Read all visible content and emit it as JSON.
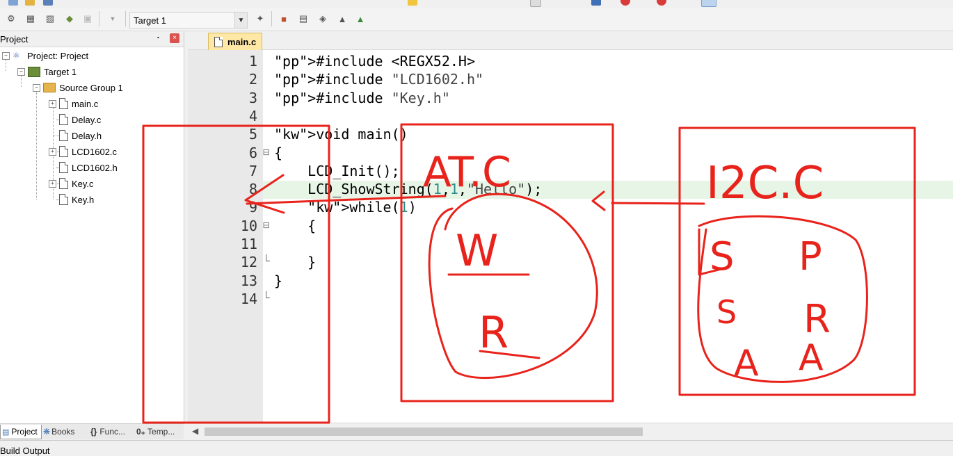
{
  "toolbar": {
    "target_name": "Target 1"
  },
  "project_panel": {
    "title": "Project",
    "pin_label": "⬝",
    "close_label": "×",
    "tree": [
      {
        "label": "Project: Project",
        "icon": "project-icon",
        "level": 0
      },
      {
        "label": "Target 1",
        "icon": "target-icon",
        "level": 1
      },
      {
        "label": "Source Group 1",
        "icon": "folder-icon",
        "level": 2
      },
      {
        "label": "main.c",
        "icon": "file-icon",
        "level": 3,
        "expandable": true
      },
      {
        "label": "Delay.c",
        "icon": "file-icon",
        "level": 3,
        "expandable": false
      },
      {
        "label": "Delay.h",
        "icon": "file-icon",
        "level": 3,
        "expandable": false
      },
      {
        "label": "LCD1602.c",
        "icon": "file-icon",
        "level": 3,
        "expandable": true
      },
      {
        "label": "LCD1602.h",
        "icon": "file-icon",
        "level": 3,
        "expandable": false
      },
      {
        "label": "Key.c",
        "icon": "file-icon",
        "level": 3,
        "expandable": true
      },
      {
        "label": "Key.h",
        "icon": "file-icon",
        "level": 3,
        "expandable": false
      }
    ],
    "bottom_tabs": [
      "Project",
      "Books",
      "Func...",
      "Temp..."
    ]
  },
  "editor": {
    "tab_label": "main.c",
    "lines": [
      {
        "n": "1",
        "text": "#include <REGX52.H>"
      },
      {
        "n": "2",
        "text": "#include \"LCD1602.h\""
      },
      {
        "n": "3",
        "text": "#include \"Key.h\""
      },
      {
        "n": "4",
        "text": ""
      },
      {
        "n": "5",
        "text": "void main()"
      },
      {
        "n": "6",
        "text": "{"
      },
      {
        "n": "7",
        "text": "    LCD_Init();"
      },
      {
        "n": "8",
        "text": "    LCD_ShowString(1,1,\"Hello\");"
      },
      {
        "n": "9",
        "text": "    while(1)"
      },
      {
        "n": "10",
        "text": "    {"
      },
      {
        "n": "11",
        "text": ""
      },
      {
        "n": "12",
        "text": "    }"
      },
      {
        "n": "13",
        "text": "}"
      },
      {
        "n": "14",
        "text": ""
      }
    ]
  },
  "annotations": {
    "left_box_color": "#e8231b",
    "at_c_label": "AT.C",
    "i2c_label": "I2C.C",
    "w_label": "W",
    "r_label": "R",
    "s1": "S",
    "p": "P",
    "s2": "S",
    "r2": "R",
    "a1": "A",
    "a2": "A"
  },
  "status": {
    "build_output": "Build Output"
  }
}
